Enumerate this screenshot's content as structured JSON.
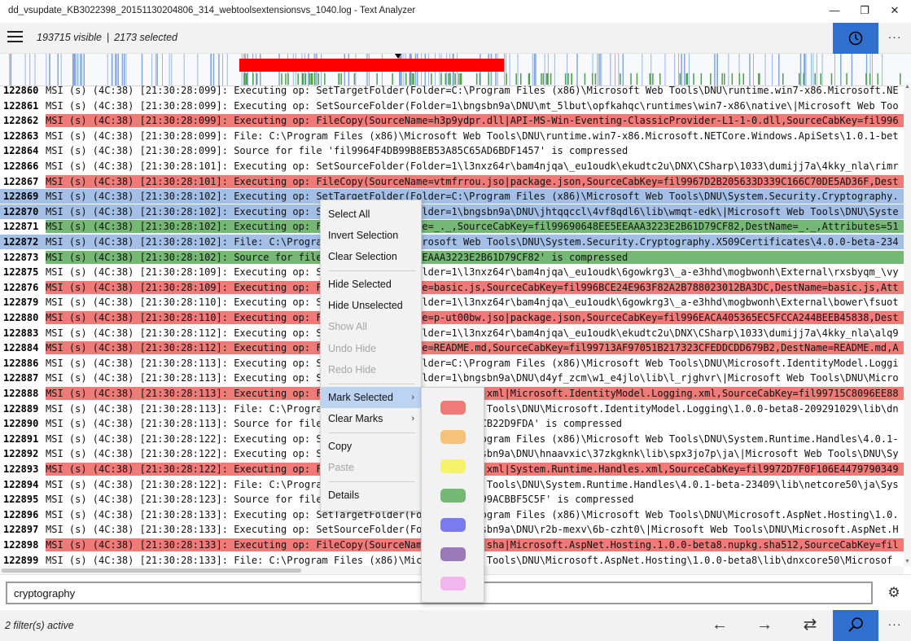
{
  "window": {
    "title": "dd_vsupdate_KB3022398_20151130204806_314_webtoolsextensionsvs_1040.log - Text Analyzer",
    "minimize_glyph": "—",
    "restore_glyph": "❐",
    "close_glyph": "✕"
  },
  "header": {
    "visible_text": "193715 visible",
    "separator": "|",
    "selected_text": "2173 selected",
    "clock_icon": "clock-icon",
    "more_glyph": "···"
  },
  "colors": {
    "accent": "#2e6fcf",
    "selection": "#a3bfe6",
    "mark_red": "#f07a78",
    "mark_green": "#74b874",
    "overview_bar": "#ff0000"
  },
  "overview": {
    "description_icon": "overview-minimap"
  },
  "log": {
    "rows": [
      {
        "num": "122860",
        "text": "MSI (s) (4C:38) [21:30:28:099]: Executing op: SetTargetFolder(Folder=C:\\Program Files (x86)\\Microsoft Web Tools\\DNU\\runtime.win7-x86.Microsoft.NE",
        "state": "",
        "mark": ""
      },
      {
        "num": "122861",
        "text": "MSI (s) (4C:38) [21:30:28:099]: Executing op: SetSourceFolder(Folder=1\\bngsbn9a\\DNU\\mt_5lbut\\opfkahqc\\runtimes\\win7-x86\\native\\|Microsoft Web Too",
        "state": "",
        "mark": ""
      },
      {
        "num": "122862",
        "text": "MSI (s) (4C:38) [21:30:28:099]: Executing op: FileCopy(SourceName=h3p9ydpr.dll|API-MS-Win-Eventing-ClassicProvider-L1-1-0.dll,SourceCabKey=fil996",
        "state": "",
        "mark": "red"
      },
      {
        "num": "122863",
        "text": "MSI (s) (4C:38) [21:30:28:099]: File: C:\\Program Files (x86)\\Microsoft Web Tools\\DNU\\runtime.win7-x86.Microsoft.NETCore.Windows.ApiSets\\1.0.1-bet",
        "state": "",
        "mark": ""
      },
      {
        "num": "122864",
        "text": "MSI (s) (4C:38) [21:30:28:099]: Source for file 'fil9964F4DB99B8EB53A85C65AD6BDF1457' is compressed",
        "state": "",
        "mark": ""
      },
      {
        "num": "122866",
        "text": "MSI (s) (4C:38) [21:30:28:101]: Executing op: SetSourceFolder(Folder=1\\l3nxz64r\\bam4njqa\\_eu1oudk\\ekudtc2u\\DNX\\CSharp\\1033\\dumijj7a\\4kky_nla\\rimr",
        "state": "",
        "mark": ""
      },
      {
        "num": "122867",
        "text": "MSI (s) (4C:38) [21:30:28:101]: Executing op: FileCopy(SourceName=vtmfrrou.jso|package.json,SourceCabKey=fil9967D2B205633D339C166C70DE5AD36F,Dest",
        "state": "",
        "mark": "red"
      },
      {
        "num": "122869",
        "text": "MSI (s) (4C:38) [21:30:28:102]: Executing op: SetTargetFolder(Folder=C:\\Program Files (x86)\\Microsoft Web Tools\\DNU\\System.Security.Cryptography.",
        "state": "sel",
        "mark": ""
      },
      {
        "num": "122870",
        "text": "MSI (s) (4C:38) [21:30:28:102]: Executing op: SetSourceFolder(Folder=1\\bngsbn9a\\DNU\\jhtqqccl\\4vf8qdl6\\lib\\wmqt-edk\\|Microsoft Web Tools\\DNU\\Syste",
        "state": "sel",
        "mark": ""
      },
      {
        "num": "122871",
        "text": "MSI (s) (4C:38) [21:30:28:102]: Executing op: FileCopy(SourceName=_._,SourceCabKey=fil99690648EE5EEAAA3223E2B61D79CF82,DestName=_._,Attributes=51",
        "state": "",
        "mark": "green"
      },
      {
        "num": "122872",
        "text": "MSI (s) (4C:38) [21:30:28:102]: File: C:\\Program Files (x86)\\Microsoft Web Tools\\DNU\\System.Security.Cryptography.X509Certificates\\4.0.0-beta-234",
        "state": "sel",
        "mark": ""
      },
      {
        "num": "122873",
        "text": "MSI (s) (4C:38) [21:30:28:102]: Source for file 'fil99690648EE5EEAAA3223E2B61D79CF82' is compressed",
        "state": "",
        "mark": "green"
      },
      {
        "num": "122875",
        "text": "MSI (s) (4C:38) [21:30:28:109]: Executing op: SetSourceFolder(Folder=1\\l3nxz64r\\bam4njqa\\_eu1oudk\\6gowkrg3\\_a-e3hhd\\mogbwonh\\External\\rxsbyqm_\\vy",
        "state": "",
        "mark": ""
      },
      {
        "num": "122876",
        "text": "MSI (s) (4C:38) [21:30:28:109]: Executing op: FileCopy(SourceName=basic.js,SourceCabKey=fil996BCE24E963F82A2B788023012BA3DC,DestName=basic.js,Att",
        "state": "",
        "mark": "red"
      },
      {
        "num": "122879",
        "text": "MSI (s) (4C:38) [21:30:28:110]: Executing op: SetSourceFolder(Folder=1\\l3nxz64r\\bam4njqa\\_eu1oudk\\6gowkrg3\\_a-e3hhd\\mogbwonh\\External\\bower\\fsuot",
        "state": "",
        "mark": ""
      },
      {
        "num": "122880",
        "text": "MSI (s) (4C:38) [21:30:28:110]: Executing op: FileCopy(SourceName=p-ut00bw.jso|package.json,SourceCabKey=fil996EACA405365EC5FCCA244BEEB45838,Dest",
        "state": "",
        "mark": "red"
      },
      {
        "num": "122883",
        "text": "MSI (s) (4C:38) [21:30:28:112]: Executing op: SetSourceFolder(Folder=1\\l3nxz64r\\bam4njqa\\_eu1oudk\\ekudtc2u\\DNX\\CSharp\\1033\\dumijj7a\\4kky_nla\\alq9",
        "state": "",
        "mark": ""
      },
      {
        "num": "122884",
        "text": "MSI (s) (4C:38) [21:30:28:112]: Executing op: FileCopy(SourceName=README.md,SourceCabKey=fil99713AF97051B217323CFEDDCDD679B2,DestName=README.md,A",
        "state": "",
        "mark": "red"
      },
      {
        "num": "122886",
        "text": "MSI (s) (4C:38) [21:30:28:113]: Executing op: SetTargetFolder(Folder=C:\\Program Files (x86)\\Microsoft Web Tools\\DNU\\Microsoft.IdentityModel.Loggi",
        "state": "",
        "mark": ""
      },
      {
        "num": "122887",
        "text": "MSI (s) (4C:38) [21:30:28:113]: Executing op: SetSourceFolder(Folder=1\\bngsbn9a\\DNU\\d4yf_zcm\\w1_e4jlo\\lib\\l_rjghvr\\|Microsoft Web Tools\\DNU\\Micro",
        "state": "",
        "mark": ""
      },
      {
        "num": "122888",
        "text": "MSI (s) (4C:38) [21:30:28:113]: Executing op: FileCopy(SourceName=o_zd3gb4.xml|Microsoft.IdentityModel.Logging.xml,SourceCabKey=fil99715C8096EE88",
        "state": "",
        "mark": "red"
      },
      {
        "num": "122889",
        "text": "MSI (s) (4C:38) [21:30:28:113]: File: C:\\Program Files (x86)\\Microsoft Web Tools\\DNU\\Microsoft.IdentityModel.Logging\\1.0.0-beta8-209291029\\lib\\dn",
        "state": "",
        "mark": ""
      },
      {
        "num": "122890",
        "text": "MSI (s) (4C:38) [21:30:28:113]: Source for file 'fil99715C8096EE886D80E9E5CB22D9FDA' is compressed",
        "state": "",
        "mark": ""
      },
      {
        "num": "122891",
        "text": "MSI (s) (4C:38) [21:30:28:122]: Executing op: SetTargetFolder(Folder=C:\\Program Files (x86)\\Microsoft Web Tools\\DNU\\System.Runtime.Handles\\4.0.1-",
        "state": "",
        "mark": ""
      },
      {
        "num": "122892",
        "text": "MSI (s) (4C:38) [21:30:28:122]: Executing op: SetSourceFolder(Folder=1\\bngsbn9a\\DNU\\hnaavxic\\37zkgknk\\lib\\spx3jo7p\\ja\\|Microsoft Web Tools\\DNU\\Sy",
        "state": "",
        "mark": ""
      },
      {
        "num": "122893",
        "text": "MSI (s) (4C:38) [21:30:28:122]: Executing op: FileCopy(SourceName=9y8xwbxa.xml|System.Runtime.Handles.xml,SourceCabKey=fil9972D7F0F106E4479790349",
        "state": "",
        "mark": "red"
      },
      {
        "num": "122894",
        "text": "MSI (s) (4C:38) [21:30:28:122]: File: C:\\Program Files (x86)\\Microsoft Web Tools\\DNU\\System.Runtime.Handles\\4.0.1-beta-23409\\lib\\netcore50\\ja\\Sys",
        "state": "",
        "mark": ""
      },
      {
        "num": "122895",
        "text": "MSI (s) (4C:38) [21:30:28:123]: Source for file 'fil9972D7F0F106E44797903499ACBBF5C5F' is compressed",
        "state": "",
        "mark": ""
      },
      {
        "num": "122896",
        "text": "MSI (s) (4C:38) [21:30:28:133]: Executing op: SetTargetFolder(Folder=C:\\Program Files (x86)\\Microsoft Web Tools\\DNU\\Microsoft.AspNet.Hosting\\1.0.",
        "state": "",
        "mark": ""
      },
      {
        "num": "122897",
        "text": "MSI (s) (4C:38) [21:30:28:133]: Executing op: SetSourceFolder(Folder=1\\bngsbn9a\\DNU\\r2b-mexv\\6b-czht0\\|Microsoft Web Tools\\DNU\\Microsoft.AspNet.H",
        "state": "",
        "mark": ""
      },
      {
        "num": "122898",
        "text": "MSI (s) (4C:38) [21:30:28:133]: Executing op: FileCopy(SourceName=kcbnp8yl.sha|Microsoft.AspNet.Hosting.1.0.0-beta8.nupkg.sha512,SourceCabKey=fil",
        "state": "",
        "mark": "red"
      },
      {
        "num": "122899",
        "text": "MSI (s) (4C:38) [21:30:28:133]: File: C:\\Program Files (x86)\\Microsoft Web Tools\\DNU\\Microsoft.AspNet.Hosting\\1.0.0-beta8\\lib\\dnxcore50\\Microsof",
        "state": "",
        "mark": ""
      }
    ]
  },
  "context_menu": {
    "select_all": "Select All",
    "invert_selection": "Invert Selection",
    "clear_selection": "Clear Selection",
    "hide_selected": "Hide Selected",
    "hide_unselected": "Hide Unselected",
    "show_all": "Show All",
    "undo_hide": "Undo Hide",
    "redo_hide": "Redo Hide",
    "mark_selected": "Mark Selected",
    "clear_marks": "Clear Marks",
    "copy": "Copy",
    "paste": "Paste",
    "details": "Details",
    "chevron": "›"
  },
  "mark_colors": [
    {
      "name": "red",
      "hex": "#f07a78"
    },
    {
      "name": "orange",
      "hex": "#f6c27a"
    },
    {
      "name": "yellow",
      "hex": "#f6f26a"
    },
    {
      "name": "green",
      "hex": "#74b874"
    },
    {
      "name": "blue",
      "hex": "#7b7bf0"
    },
    {
      "name": "purple",
      "hex": "#9b78b8"
    },
    {
      "name": "pink",
      "hex": "#f2b6ee"
    }
  ],
  "search": {
    "value": "cryptography",
    "settings_icon": "gear-icon"
  },
  "footer": {
    "filters_text": "2 filter(s) active",
    "back_glyph": "←",
    "forward_glyph": "→",
    "swap_glyph": "⇄"
  }
}
